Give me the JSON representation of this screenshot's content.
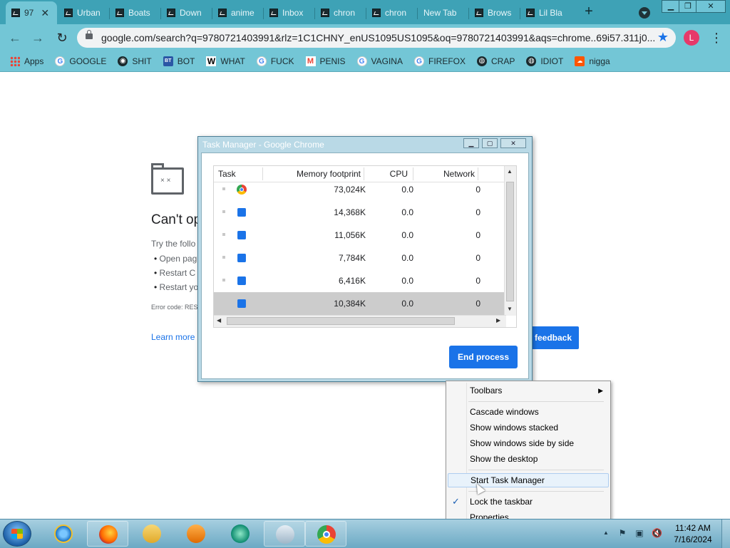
{
  "tabs": [
    {
      "label": "97",
      "active": true
    },
    {
      "label": "Urban"
    },
    {
      "label": "Boats"
    },
    {
      "label": "Down"
    },
    {
      "label": "anime"
    },
    {
      "label": "Inbox"
    },
    {
      "label": "chron"
    },
    {
      "label": "chron"
    },
    {
      "label": "New Tab"
    },
    {
      "label": "Brows"
    },
    {
      "label": "Lil Bla"
    }
  ],
  "toolbar": {
    "url": "google.com/search?q=9780721403991&rlz=1C1CHNY_enUS1095US1095&oq=9780721403991&aqs=chrome..69i57.311j0...",
    "profile_initial": "L"
  },
  "bookmarks": [
    {
      "label": "Apps",
      "icon": "apps-grid-icon"
    },
    {
      "label": "GOOGLE",
      "icon": "google-icon"
    },
    {
      "label": "SHIT",
      "icon": "dark-circle-icon"
    },
    {
      "label": "BOT",
      "icon": "bt-icon"
    },
    {
      "label": "WHAT",
      "icon": "wikipedia-icon"
    },
    {
      "label": "FUCK",
      "icon": "google-icon"
    },
    {
      "label": "PENIS",
      "icon": "gmail-icon"
    },
    {
      "label": "VAGINA",
      "icon": "google-icon"
    },
    {
      "label": "FIREFOX",
      "icon": "google-icon"
    },
    {
      "label": "CRAP",
      "icon": "globe-icon"
    },
    {
      "label": "IDIOT",
      "icon": "globe-icon"
    },
    {
      "label": "nigga",
      "icon": "soundcloud-icon"
    }
  ],
  "error_page": {
    "title": "Can't op",
    "try_text": "Try the follo",
    "items": [
      "Open pag",
      "Restart C",
      "Restart yo"
    ],
    "error_code": "Error code: RESU",
    "learn_more": "Learn more",
    "feedback": "feedback"
  },
  "task_manager": {
    "title": "Task Manager - Google Chrome",
    "columns": [
      "Task",
      "Memory footprint",
      "CPU",
      "Network"
    ],
    "rows": [
      {
        "icon": "chrome-icon",
        "memory": "73,024K",
        "cpu": "0.0",
        "network": "0"
      },
      {
        "icon": "extension-puzzle-icon",
        "memory": "14,368K",
        "cpu": "0.0",
        "network": "0"
      },
      {
        "icon": "extension-puzzle-icon",
        "memory": "11,056K",
        "cpu": "0.0",
        "network": "0"
      },
      {
        "icon": "extension-puzzle-icon",
        "memory": "7,784K",
        "cpu": "0.0",
        "network": "0"
      },
      {
        "icon": "extension-puzzle-icon",
        "memory": "6,416K",
        "cpu": "0.0",
        "network": "0"
      },
      {
        "icon": "extension-puzzle-icon",
        "memory": "10,384K",
        "cpu": "0.0",
        "network": "0",
        "selected": true
      }
    ],
    "end_process": "End process"
  },
  "context_menu": {
    "items": [
      {
        "label": "Toolbars",
        "submenu": true
      },
      {
        "label": "Cascade windows"
      },
      {
        "label": "Show windows stacked"
      },
      {
        "label": "Show windows side by side"
      },
      {
        "label": "Show the desktop"
      },
      {
        "label": "Start Task Manager",
        "hovered": true
      },
      {
        "label": "Lock the taskbar",
        "checked": true
      },
      {
        "label": "Properties"
      }
    ]
  },
  "taskbar": {
    "apps": [
      "internet-explorer-icon",
      "firefox-icon",
      "file-explorer-icon",
      "media-player-icon",
      "fish-app-icon",
      "disk-utility-icon",
      "chrome-icon"
    ],
    "time": "11:42 AM",
    "date": "7/16/2024"
  },
  "colors": {
    "tab_strip": "#3ea2b6",
    "toolbar": "#73c6d6",
    "accent_blue": "#1a73e8"
  }
}
